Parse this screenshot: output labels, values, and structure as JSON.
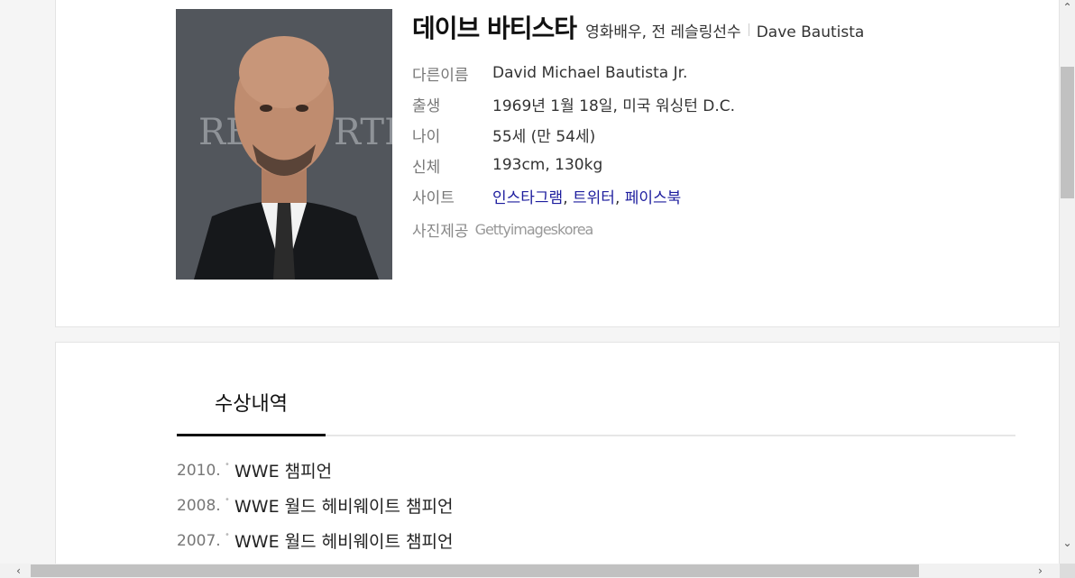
{
  "profile": {
    "name": "데이브 바티스타",
    "occupation": "영화배우, 전 레슬링선수",
    "english_name": "Dave Bautista",
    "photo_icon": "person-photo",
    "rows": [
      {
        "label": "다른이름",
        "value": "David Michael Bautista Jr."
      },
      {
        "label": "출생",
        "value": "1969년 1월 18일, 미국 워싱턴 D.C."
      },
      {
        "label": "나이",
        "value": "55세 (만 54세)"
      },
      {
        "label": "신체",
        "value": "193cm, 130kg"
      }
    ],
    "site": {
      "label": "사이트",
      "links": [
        "인스타그램",
        "트위터",
        "페이스북"
      ],
      "separator": ", "
    },
    "credit": {
      "label": "사진제공",
      "source": "Gettyimageskorea"
    }
  },
  "awards": {
    "tab_label": "수상내역",
    "items": [
      {
        "year": "2010.",
        "title": "WWE 챔피언"
      },
      {
        "year": "2008.",
        "title": "WWE 월드 헤비웨이트 챔피언"
      },
      {
        "year": "2007.",
        "title": "WWE 월드 헤비웨이트 챔피언"
      }
    ]
  },
  "colors": {
    "link": "#1d1d9e",
    "tab_underline": "#111111"
  }
}
